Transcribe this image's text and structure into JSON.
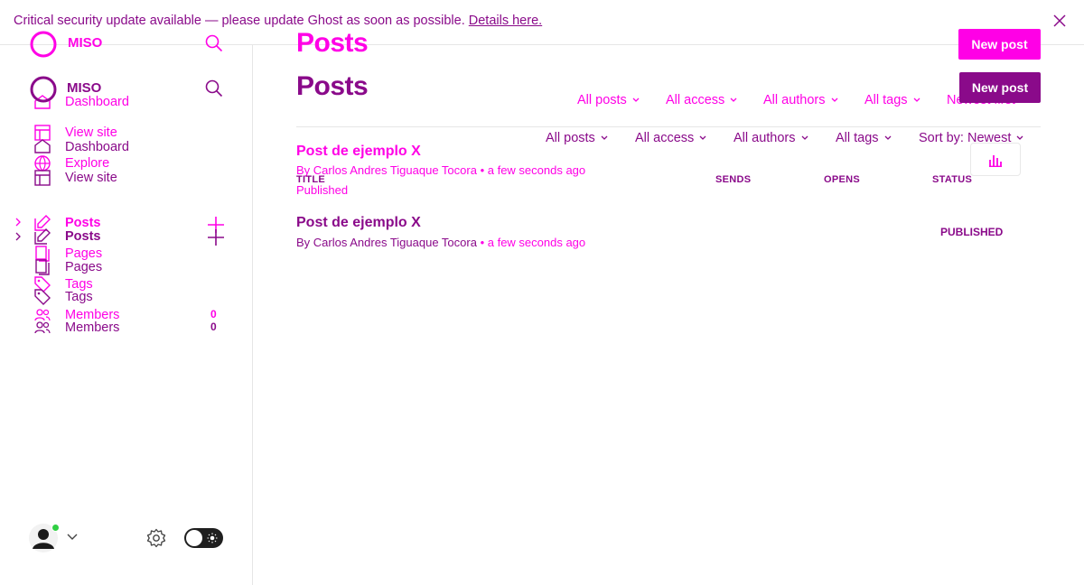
{
  "banner": {
    "text": "Critical security update available — please update Ghost as soon as possible.",
    "link": "Details here."
  },
  "brand": {
    "name": "MISO"
  },
  "nav": {
    "dashboard": "Dashboard",
    "view_site": "View site",
    "explore": "Explore",
    "posts": "Posts",
    "pages": "Pages",
    "tags": "Tags",
    "members": "Members",
    "members_count": "0"
  },
  "header": {
    "title": "Posts",
    "new_post": "New post"
  },
  "filters": {
    "ghost": [
      "All posts",
      "All access",
      "All authors",
      "All tags",
      "Newest first"
    ],
    "main": [
      "All posts",
      "All access",
      "All authors",
      "All tags",
      "Sort by: Newest"
    ]
  },
  "table": {
    "columns": [
      "TITLE",
      "SENDS",
      "OPENS",
      "STATUS"
    ]
  },
  "posts_ghost": [
    {
      "title": "Post de ejemplo X",
      "by": "By",
      "author": "Carlos Andres Tiguaque Tocora",
      "time": "• a few seconds ago",
      "status": "Published"
    }
  ],
  "posts": [
    {
      "title": "Post de ejemplo X",
      "by": "By",
      "author": "Carlos Andres Tiguaque Tocora",
      "time": "• a few seconds ago",
      "status": "PUBLISHED"
    }
  ],
  "colors": {
    "magenta": "#ff00e6",
    "purple": "#8a0a8a",
    "status_green": "#30cf43"
  }
}
